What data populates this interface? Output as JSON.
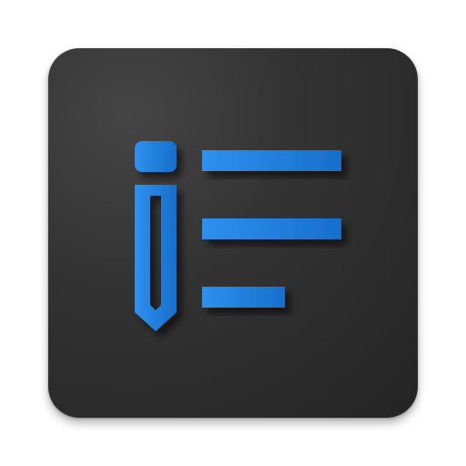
{
  "icon": {
    "name": "notes-list-edit-icon",
    "background_color": "#2b2b2b",
    "glyph_color": "#1e7fe0",
    "glyph_highlight": "#2f90ee",
    "glyph_shade": "#176fcb"
  }
}
